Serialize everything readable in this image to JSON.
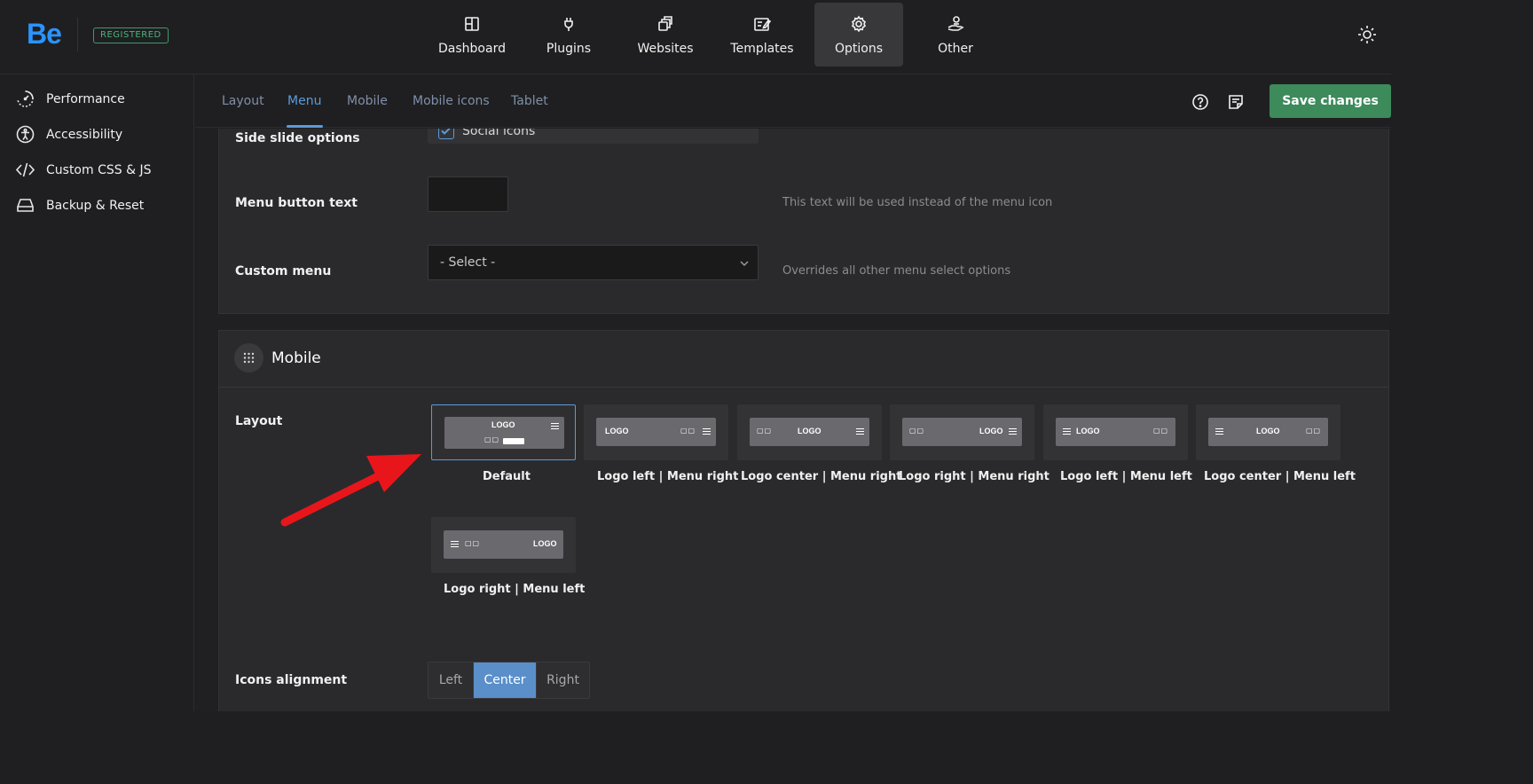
{
  "brand": {
    "logo": "Be",
    "badge": "REGISTERED"
  },
  "nav": [
    {
      "label": "Dashboard",
      "icon": "dashboard-icon"
    },
    {
      "label": "Plugins",
      "icon": "plug-icon"
    },
    {
      "label": "Websites",
      "icon": "websites-icon"
    },
    {
      "label": "Templates",
      "icon": "templates-icon"
    },
    {
      "label": "Options",
      "icon": "gear-icon",
      "active": true
    },
    {
      "label": "Other",
      "icon": "user-hand-icon"
    }
  ],
  "sidebar": {
    "items": [
      {
        "label": "Performance",
        "icon": "performance-icon"
      },
      {
        "label": "Accessibility",
        "icon": "accessibility-icon"
      },
      {
        "label": "Custom CSS & JS",
        "icon": "code-icon"
      },
      {
        "label": "Backup & Reset",
        "icon": "drive-icon"
      }
    ]
  },
  "subtabs": [
    {
      "label": "Layout"
    },
    {
      "label": "Menu",
      "active": true
    },
    {
      "label": "Mobile"
    },
    {
      "label": "Mobile icons"
    },
    {
      "label": "Tablet"
    }
  ],
  "toolbar": {
    "save_label": "Save changes"
  },
  "menu_panel": {
    "side_slide_label": "Side slide options",
    "social_icons_label": "Social icons",
    "social_icons_checked": true,
    "menu_button_text_label": "Menu button text",
    "menu_button_text_value": "",
    "menu_button_text_hint": "This text will be used instead of the menu icon",
    "custom_menu_label": "Custom menu",
    "custom_menu_value": "- Select -",
    "custom_menu_hint": "Overrides all other menu select options"
  },
  "mobile_panel": {
    "title": "Mobile",
    "layout_label": "Layout",
    "layouts": [
      {
        "label": "Default",
        "selected": true
      },
      {
        "label": "Logo left | Menu right"
      },
      {
        "label": "Logo center | Menu right"
      },
      {
        "label": "Logo right | Menu right"
      },
      {
        "label": "Logo left | Menu left"
      },
      {
        "label": "Logo center | Menu left"
      },
      {
        "label": "Logo right | Menu left"
      }
    ],
    "mock_logo": "LOGO",
    "mock_dots": "▢▢",
    "icons_alignment_label": "Icons alignment",
    "alignment_options": [
      "Left",
      "Center",
      "Right"
    ],
    "alignment_selected": "Center"
  },
  "colors": {
    "accent": "#5b9bd9",
    "save": "#3d8a5b",
    "brand": "#2a93ff",
    "annotation_arrow": "#e8161b"
  }
}
